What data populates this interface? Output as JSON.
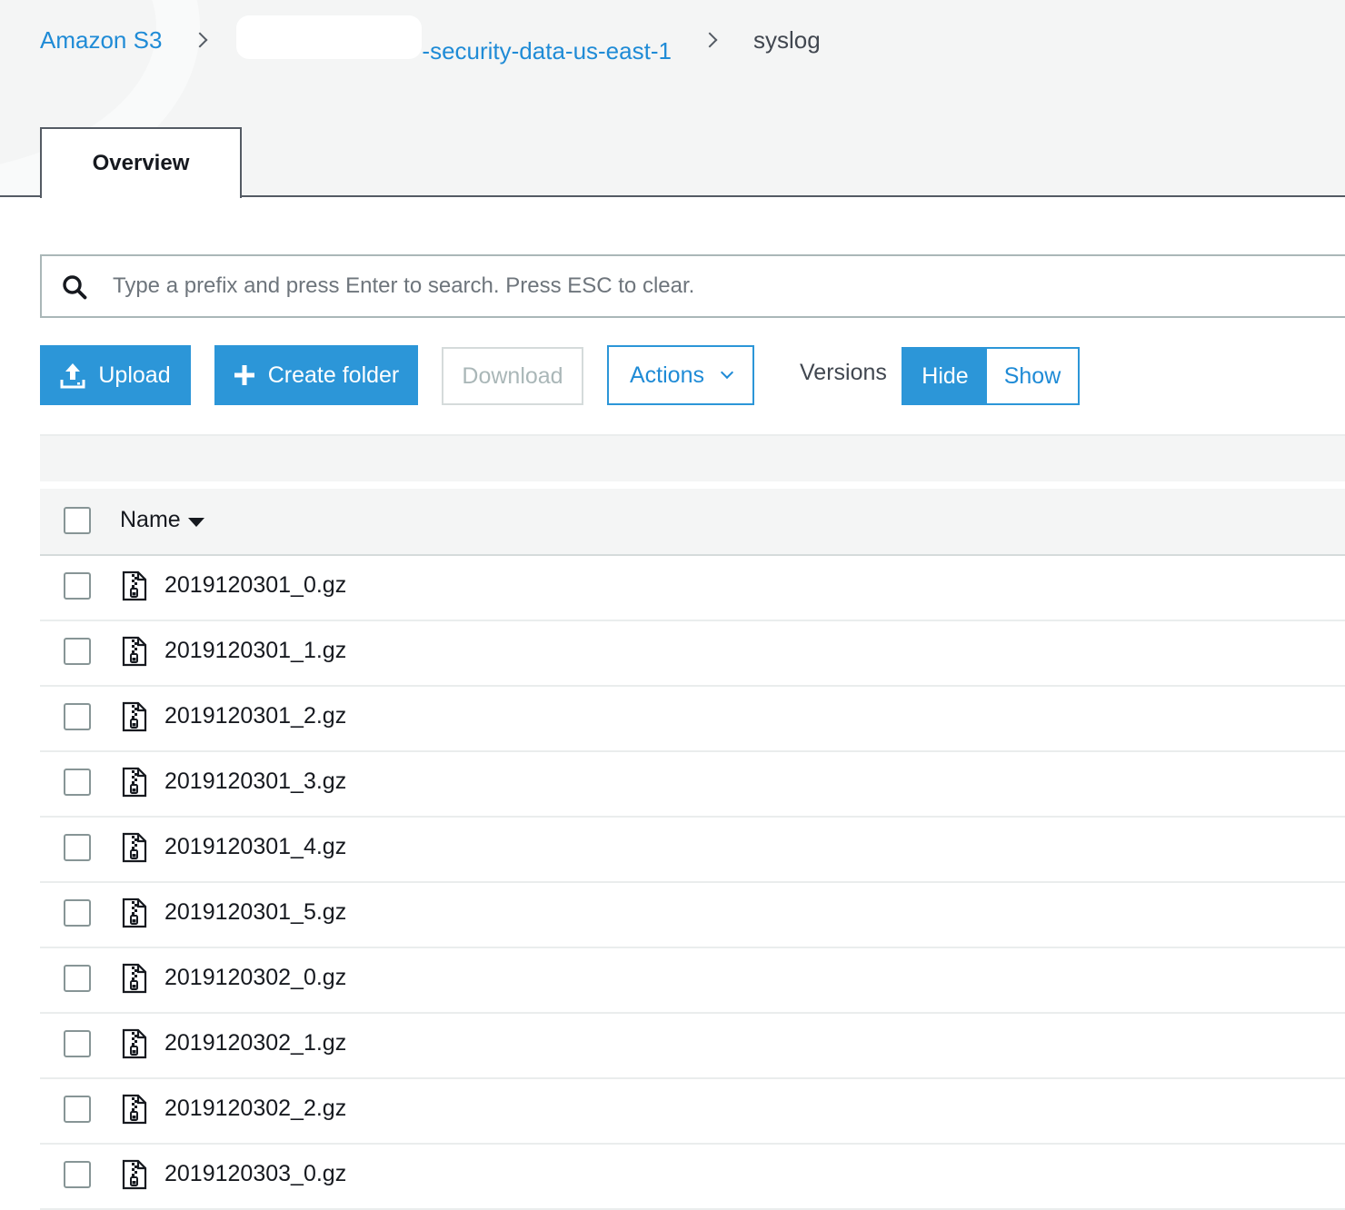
{
  "breadcrumb": {
    "root": "Amazon S3",
    "bucket_suffix": "-security-data-us-east-1",
    "current": "syslog"
  },
  "tabs": [
    {
      "label": "Overview",
      "active": true
    }
  ],
  "search": {
    "placeholder": "Type a prefix and press Enter to search. Press ESC to clear.",
    "value": ""
  },
  "toolbar": {
    "upload_label": "Upload",
    "create_folder_label": "Create folder",
    "download_label": "Download",
    "actions_label": "Actions",
    "versions_label": "Versions",
    "hide_label": "Hide",
    "show_label": "Show"
  },
  "table": {
    "name_header": "Name",
    "rows": [
      {
        "name": "2019120301_0.gz"
      },
      {
        "name": "2019120301_1.gz"
      },
      {
        "name": "2019120301_2.gz"
      },
      {
        "name": "2019120301_3.gz"
      },
      {
        "name": "2019120301_4.gz"
      },
      {
        "name": "2019120301_5.gz"
      },
      {
        "name": "2019120302_0.gz"
      },
      {
        "name": "2019120302_1.gz"
      },
      {
        "name": "2019120302_2.gz"
      },
      {
        "name": "2019120303_0.gz"
      }
    ]
  },
  "colors": {
    "accent": "#2c96d8",
    "link": "#1f8bd6",
    "disabled": "#aab7b8"
  },
  "icons": {
    "search": "search-icon",
    "upload": "upload-icon",
    "create_folder": "plus-icon",
    "actions": "chevron-down-icon",
    "sort": "caret-down-icon",
    "file": "zip-file-icon"
  }
}
